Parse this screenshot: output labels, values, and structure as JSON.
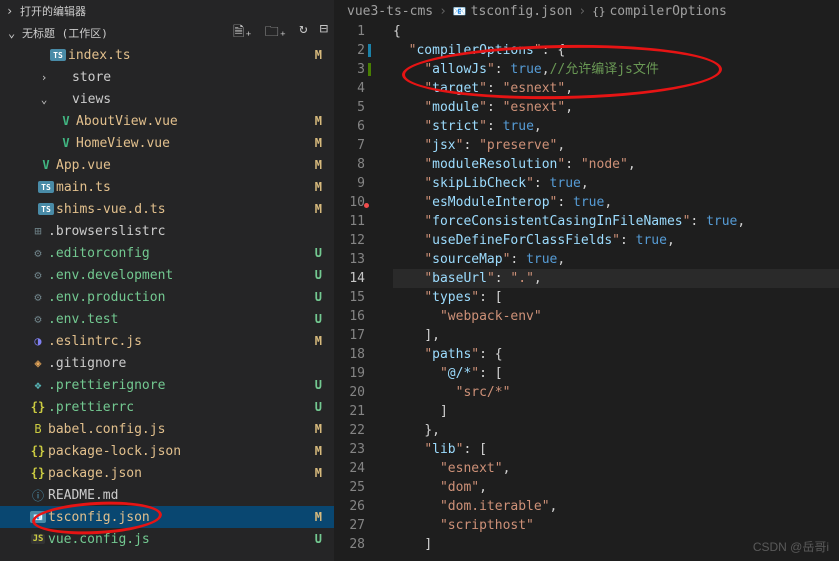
{
  "sections": {
    "openEditors": "打开的编辑器",
    "workspace": "无标题 (工作区)"
  },
  "tree": [
    {
      "type": "file",
      "indent": 48,
      "icon": "ts",
      "iconText": "TS",
      "label": "index.ts",
      "git": "M"
    },
    {
      "type": "folder",
      "indent": 36,
      "twisty": "›",
      "label": "store"
    },
    {
      "type": "folder",
      "indent": 36,
      "twisty": "⌄",
      "label": "views"
    },
    {
      "type": "file",
      "indent": 56,
      "icon": "vue",
      "iconText": "V",
      "label": "AboutView.vue",
      "git": "M"
    },
    {
      "type": "file",
      "indent": 56,
      "icon": "vue",
      "iconText": "V",
      "label": "HomeView.vue",
      "git": "M"
    },
    {
      "type": "file",
      "indent": 36,
      "icon": "vue",
      "iconText": "V",
      "label": "App.vue",
      "git": "M"
    },
    {
      "type": "file",
      "indent": 36,
      "icon": "ts",
      "iconText": "TS",
      "label": "main.ts",
      "git": "M"
    },
    {
      "type": "file",
      "indent": 36,
      "icon": "ts",
      "iconText": "TS",
      "label": "shims-vue.d.ts",
      "git": "M"
    },
    {
      "type": "file",
      "indent": 28,
      "icon": "config",
      "iconText": "⊞",
      "label": ".browserslistrc"
    },
    {
      "type": "file",
      "indent": 28,
      "icon": "gear",
      "iconText": "⚙",
      "label": ".editorconfig",
      "git": "U"
    },
    {
      "type": "file",
      "indent": 28,
      "icon": "gear",
      "iconText": "⚙",
      "label": ".env.development",
      "git": "U"
    },
    {
      "type": "file",
      "indent": 28,
      "icon": "gear",
      "iconText": "⚙",
      "label": ".env.production",
      "git": "U"
    },
    {
      "type": "file",
      "indent": 28,
      "icon": "gear",
      "iconText": "⚙",
      "label": ".env.test",
      "git": "U"
    },
    {
      "type": "file",
      "indent": 28,
      "icon": "eslint",
      "iconText": "◑",
      "label": ".eslintrc.js",
      "git": "M"
    },
    {
      "type": "file",
      "indent": 28,
      "icon": "git",
      "iconText": "◈",
      "label": ".gitignore"
    },
    {
      "type": "file",
      "indent": 28,
      "icon": "prettier",
      "iconText": "❖",
      "label": ".prettierignore",
      "git": "U"
    },
    {
      "type": "file",
      "indent": 28,
      "icon": "json",
      "iconText": "{}",
      "label": ".prettierrc",
      "git": "U"
    },
    {
      "type": "file",
      "indent": 28,
      "icon": "babel",
      "iconText": "B",
      "label": "babel.config.js",
      "git": "M"
    },
    {
      "type": "file",
      "indent": 28,
      "icon": "json",
      "iconText": "{}",
      "label": "package-lock.json",
      "git": "M"
    },
    {
      "type": "file",
      "indent": 28,
      "icon": "json",
      "iconText": "{}",
      "label": "package.json",
      "git": "M"
    },
    {
      "type": "file",
      "indent": 28,
      "icon": "readme",
      "iconText": "ⓘ",
      "label": "README.md"
    },
    {
      "type": "file",
      "indent": 28,
      "icon": "ts",
      "iconText": "📧",
      "label": "tsconfig.json",
      "git": "M",
      "selected": true
    },
    {
      "type": "file",
      "indent": 28,
      "icon": "js",
      "iconText": "JS",
      "label": "vue.config.js",
      "git": "U"
    }
  ],
  "breadcrumb": {
    "project": "vue3-ts-cms",
    "file": "tsconfig.json",
    "symbol": "compilerOptions"
  },
  "code": {
    "activeLine": 14,
    "lines": [
      {
        "n": 1,
        "html": "<span class='tok-brace'>{</span>"
      },
      {
        "n": 2,
        "mod": true,
        "html": "  <span class='tok-quote'>\"</span><span class='tok-prop'>compilerOptions</span><span class='tok-quote'>\"</span><span class='tok-punc'>: {</span>"
      },
      {
        "n": 3,
        "add": true,
        "html": "    <span class='tok-quote'>\"</span><span class='tok-prop'>allowJs</span><span class='tok-quote'>\"</span><span class='tok-punc'>: </span><span class='tok-kw'>true</span><span class='tok-punc'>,</span><span class='tok-comment'>//允许编译js文件</span>"
      },
      {
        "n": 4,
        "html": "    <span class='tok-quote'>\"</span><span class='tok-prop'>target</span><span class='tok-quote'>\"</span><span class='tok-punc'>: </span><span class='tok-str'>\"esnext\"</span><span class='tok-punc'>,</span>"
      },
      {
        "n": 5,
        "html": "    <span class='tok-quote'>\"</span><span class='tok-prop'>module</span><span class='tok-quote'>\"</span><span class='tok-punc'>: </span><span class='tok-str'>\"esnext\"</span><span class='tok-punc'>,</span>"
      },
      {
        "n": 6,
        "html": "    <span class='tok-quote'>\"</span><span class='tok-prop'>strict</span><span class='tok-quote'>\"</span><span class='tok-punc'>: </span><span class='tok-kw'>true</span><span class='tok-punc'>,</span>"
      },
      {
        "n": 7,
        "html": "    <span class='tok-quote'>\"</span><span class='tok-prop'>jsx</span><span class='tok-quote'>\"</span><span class='tok-punc'>: </span><span class='tok-str'>\"preserve\"</span><span class='tok-punc'>,</span>"
      },
      {
        "n": 8,
        "html": "    <span class='tok-quote'>\"</span><span class='tok-prop'>moduleResolution</span><span class='tok-quote'>\"</span><span class='tok-punc'>: </span><span class='tok-str'>\"node\"</span><span class='tok-punc'>,</span>"
      },
      {
        "n": 9,
        "html": "    <span class='tok-quote'>\"</span><span class='tok-prop'>skipLibCheck</span><span class='tok-quote'>\"</span><span class='tok-punc'>: </span><span class='tok-kw'>true</span><span class='tok-punc'>,</span>"
      },
      {
        "n": 10,
        "html": "    <span class='tok-quote'>\"</span><span class='tok-prop'>esModuleInterop</span><span class='tok-quote'>\"</span><span class='tok-punc'>: </span><span class='tok-kw'>true</span><span class='tok-punc'>,</span>"
      },
      {
        "n": 11,
        "html": "    <span class='tok-quote'>\"</span><span class='tok-prop'>forceConsistentCasingInFileNames</span><span class='tok-quote'>\"</span><span class='tok-punc'>: </span><span class='tok-kw'>true</span><span class='tok-punc'>,</span>"
      },
      {
        "n": 12,
        "html": "    <span class='tok-quote'>\"</span><span class='tok-prop'>useDefineForClassFields</span><span class='tok-quote'>\"</span><span class='tok-punc'>: </span><span class='tok-kw'>true</span><span class='tok-punc'>,</span>"
      },
      {
        "n": 13,
        "html": "    <span class='tok-quote'>\"</span><span class='tok-prop'>sourceMap</span><span class='tok-quote'>\"</span><span class='tok-punc'>: </span><span class='tok-kw'>true</span><span class='tok-punc'>,</span>"
      },
      {
        "n": 14,
        "hl": true,
        "html": "    <span class='tok-quote'>\"</span><span class='tok-prop'>baseUrl</span><span class='tok-quote'>\"</span><span class='tok-punc'>: </span><span class='tok-str'>\".\"</span><span class='tok-punc'>,</span>"
      },
      {
        "n": 15,
        "html": "    <span class='tok-quote'>\"</span><span class='tok-prop'>types</span><span class='tok-quote'>\"</span><span class='tok-punc'>: [</span>"
      },
      {
        "n": 16,
        "html": "      <span class='tok-str'>\"webpack-env\"</span>"
      },
      {
        "n": 17,
        "html": "    <span class='tok-punc'>],</span>"
      },
      {
        "n": 18,
        "html": "    <span class='tok-quote'>\"</span><span class='tok-prop'>paths</span><span class='tok-quote'>\"</span><span class='tok-punc'>: {</span>"
      },
      {
        "n": 19,
        "html": "      <span class='tok-quote'>\"</span><span class='tok-prop'>@/*</span><span class='tok-quote'>\"</span><span class='tok-punc'>: [</span>"
      },
      {
        "n": 20,
        "html": "        <span class='tok-str'>\"src/*\"</span>"
      },
      {
        "n": 21,
        "html": "      <span class='tok-punc'>]</span>"
      },
      {
        "n": 22,
        "html": "    <span class='tok-punc'>},</span>"
      },
      {
        "n": 23,
        "html": "    <span class='tok-quote'>\"</span><span class='tok-prop'>lib</span><span class='tok-quote'>\"</span><span class='tok-punc'>: [</span>"
      },
      {
        "n": 24,
        "html": "      <span class='tok-str'>\"esnext\"</span><span class='tok-punc'>,</span>"
      },
      {
        "n": 25,
        "html": "      <span class='tok-str'>\"dom\"</span><span class='tok-punc'>,</span>"
      },
      {
        "n": 26,
        "html": "      <span class='tok-str'>\"dom.iterable\"</span><span class='tok-punc'>,</span>"
      },
      {
        "n": 27,
        "html": "      <span class='tok-str'>\"scripthost\"</span>"
      },
      {
        "n": 28,
        "html": "    <span class='tok-punc'>]</span>"
      }
    ]
  },
  "watermark": "CSDN @岳哥i"
}
